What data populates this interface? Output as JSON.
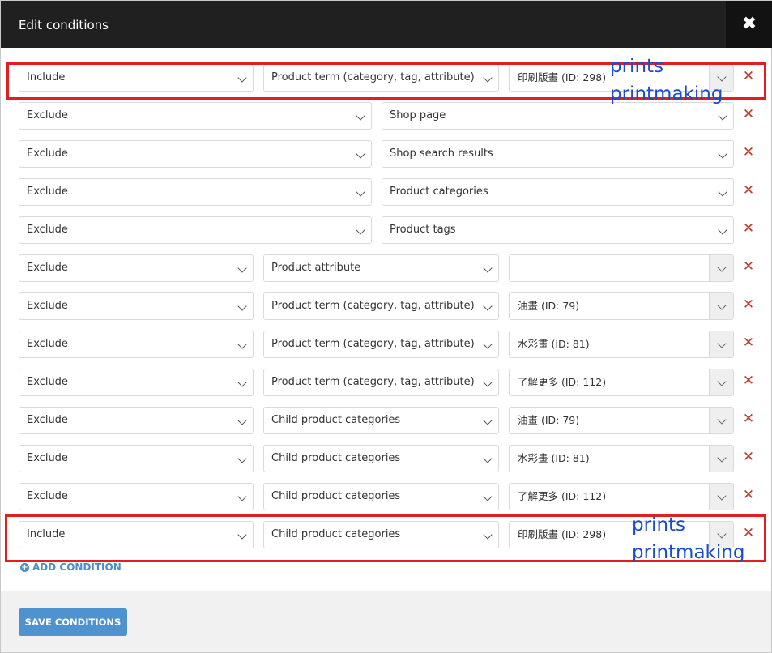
{
  "dialog": {
    "title": "Edit conditions",
    "close_label": "✖",
    "add_label": "ADD CONDITION",
    "save_label": "SAVE CONDITIONS"
  },
  "conditions": [
    {
      "type": "Include",
      "target": "Product term (category, tag, attribute)",
      "value": "印刷版畫 (ID: 298)"
    },
    {
      "type": "Exclude",
      "target": "Shop page",
      "value": ""
    },
    {
      "type": "Exclude",
      "target": "Shop search results",
      "value": ""
    },
    {
      "type": "Exclude",
      "target": "Product categories",
      "value": ""
    },
    {
      "type": "Exclude",
      "target": "Product tags",
      "value": ""
    },
    {
      "type": "Exclude",
      "target": "Product attribute",
      "value": ""
    },
    {
      "type": "Exclude",
      "target": "Product term (category, tag, attribute)",
      "value": "油畫 (ID: 79)"
    },
    {
      "type": "Exclude",
      "target": "Product term (category, tag, attribute)",
      "value": "水彩畫 (ID: 81)"
    },
    {
      "type": "Exclude",
      "target": "Product term (category, tag, attribute)",
      "value": "了解更多 (ID: 112)"
    },
    {
      "type": "Exclude",
      "target": "Child product categories",
      "value": "油畫 (ID: 79)"
    },
    {
      "type": "Exclude",
      "target": "Child product categories",
      "value": "水彩畫 (ID: 81)"
    },
    {
      "type": "Exclude",
      "target": "Child product categories",
      "value": "了解更多 (ID: 112)"
    },
    {
      "type": "Include",
      "target": "Child product categories",
      "value": "印刷版畫 (ID: 298)"
    }
  ],
  "annotations": [
    {
      "line1": "prints",
      "line2": "printmaking"
    },
    {
      "line1": "prints",
      "line2": "printmaking"
    }
  ],
  "colors": {
    "header_bg": "#202020",
    "save_button": "#4e93cf",
    "delete_icon": "#c0392b",
    "highlight_box": "#e41e20",
    "annotation_text": "#1a4ccd"
  },
  "icons": {
    "close": "close-icon",
    "delete": "delete-icon",
    "add": "plus-circle-icon",
    "dropdown": "chevron-down-icon"
  }
}
